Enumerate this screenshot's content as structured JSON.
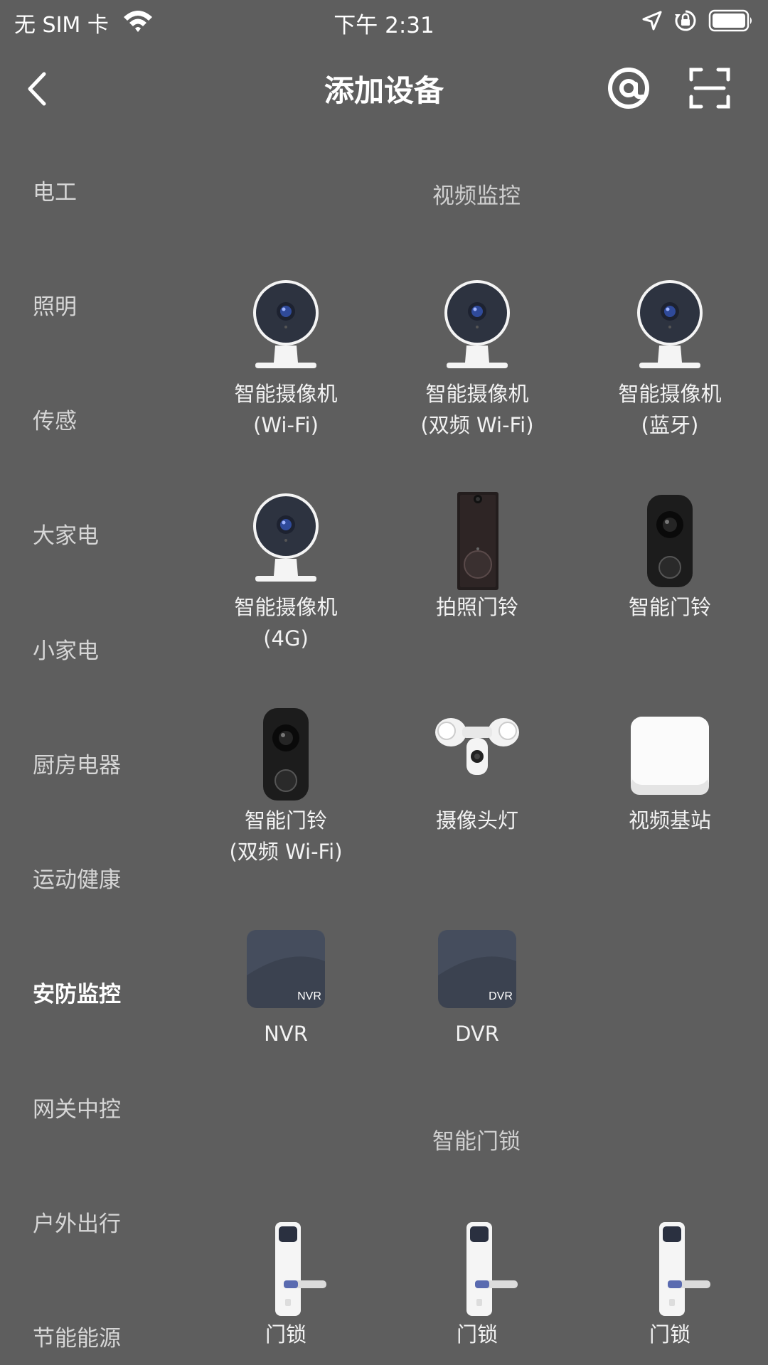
{
  "status_bar": {
    "carrier": "无 SIM 卡",
    "time": "下午 2:31"
  },
  "nav": {
    "title": "添加设备"
  },
  "sidebar": {
    "items": [
      {
        "label": "电工"
      },
      {
        "label": "照明"
      },
      {
        "label": "传感"
      },
      {
        "label": "大家电"
      },
      {
        "label": "小家电"
      },
      {
        "label": "厨房电器"
      },
      {
        "label": "运动健康"
      },
      {
        "label": "安防监控",
        "active": true
      },
      {
        "label": "网关中控"
      },
      {
        "label": "户外出行"
      },
      {
        "label": "节能能源"
      }
    ]
  },
  "sections": [
    {
      "title": "视频监控",
      "devices": [
        {
          "line1": "智能摄像机",
          "line2": "(Wi-Fi)",
          "icon": "camera-icon"
        },
        {
          "line1": "智能摄像机",
          "line2": "(双频 Wi-Fi)",
          "icon": "camera-icon"
        },
        {
          "line1": "智能摄像机",
          "line2": "(蓝牙)",
          "icon": "camera-icon"
        },
        {
          "line1": "智能摄像机",
          "line2": "(4G)",
          "icon": "camera-icon"
        },
        {
          "line1": "拍照门铃",
          "line2": "",
          "icon": "photo-doorbell-icon"
        },
        {
          "line1": "智能门铃",
          "line2": "",
          "icon": "smart-doorbell-icon"
        },
        {
          "line1": "智能门铃",
          "line2": "(双频 Wi-Fi)",
          "icon": "smart-doorbell-icon"
        },
        {
          "line1": "摄像头灯",
          "line2": "",
          "icon": "floodlight-camera-icon"
        },
        {
          "line1": "视频基站",
          "line2": "",
          "icon": "video-base-station-icon"
        },
        {
          "line1": "NVR",
          "line2": "",
          "icon": "nvr-icon",
          "badge": "NVR"
        },
        {
          "line1": "DVR",
          "line2": "",
          "icon": "dvr-icon",
          "badge": "DVR"
        }
      ]
    },
    {
      "title": "智能门锁",
      "devices": [
        {
          "line1": "门锁",
          "line2": "",
          "icon": "door-lock-icon"
        },
        {
          "line1": "门锁",
          "line2": "",
          "icon": "door-lock-icon"
        },
        {
          "line1": "门锁",
          "line2": "",
          "icon": "door-lock-icon"
        }
      ]
    }
  ]
}
